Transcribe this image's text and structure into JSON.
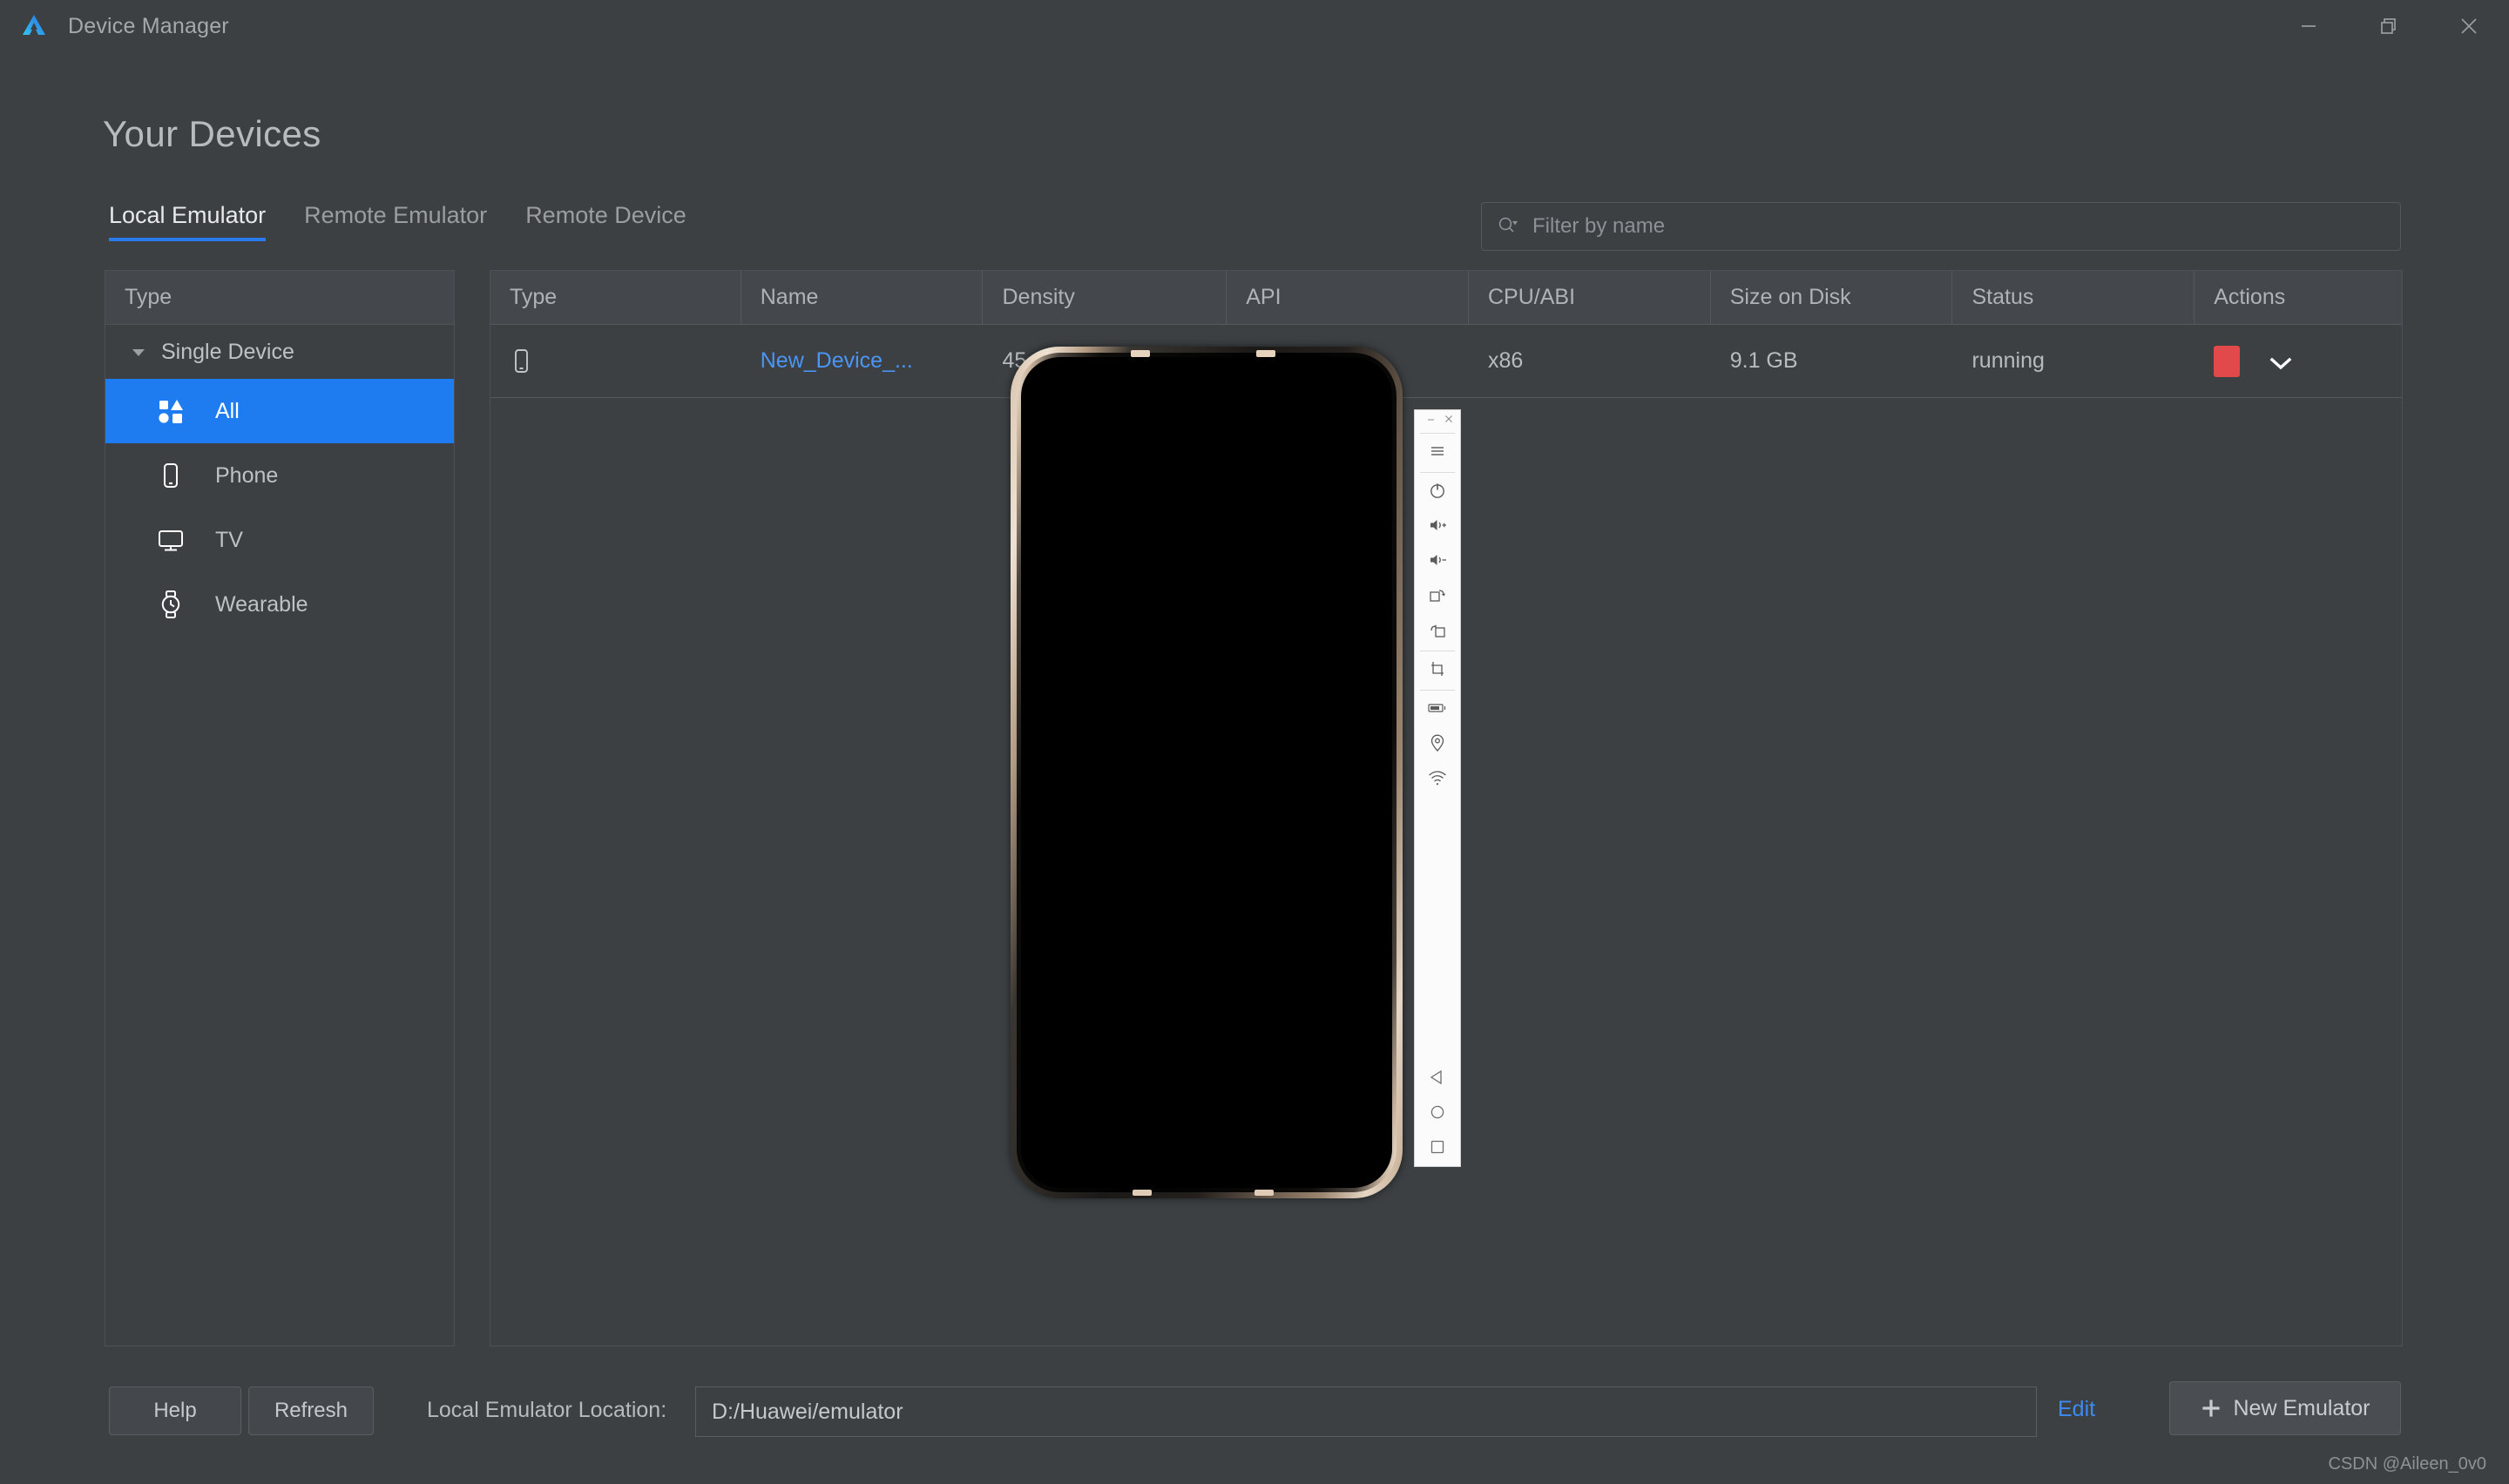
{
  "window": {
    "title": "Device Manager",
    "logo_icon": "deveco-logo-icon",
    "controls": [
      {
        "name": "minimize",
        "icon": "minimize-icon"
      },
      {
        "name": "restore",
        "icon": "restore-icon"
      },
      {
        "name": "close",
        "icon": "close-icon"
      }
    ]
  },
  "page": {
    "heading": "Your Devices"
  },
  "tabs": [
    {
      "label": "Local Emulator",
      "active": true
    },
    {
      "label": "Remote Emulator",
      "active": false
    },
    {
      "label": "Remote Device",
      "active": false
    }
  ],
  "search": {
    "icon": "search-icon",
    "placeholder": "Filter by name",
    "value": ""
  },
  "sidebar": {
    "header": "Type",
    "tree_group": {
      "label": "Single Device",
      "caret": "chevron-down-icon",
      "expanded": true
    },
    "items": [
      {
        "label": "All",
        "icon": "shapes-grid-icon",
        "selected": true
      },
      {
        "label": "Phone",
        "icon": "phone-icon",
        "selected": false
      },
      {
        "label": "TV",
        "icon": "tv-icon",
        "selected": false
      },
      {
        "label": "Wearable",
        "icon": "watch-icon",
        "selected": false
      }
    ]
  },
  "table": {
    "columns": [
      "Type",
      "Name",
      "Density",
      "API",
      "CPU/ABI",
      "Size on Disk",
      "Status",
      "Actions"
    ],
    "rows": [
      {
        "type_icon": "phone-icon",
        "name": "New_Device_...",
        "density": "45",
        "api": "",
        "cpu_abi": "x86",
        "size_on_disk": "9.1 GB",
        "status": "running",
        "actions": {
          "stop_icon": "stop-square-icon",
          "menu_icon": "chevron-down-icon"
        }
      }
    ]
  },
  "bottom_bar": {
    "help_label": "Help",
    "refresh_label": "Refresh",
    "location_label": "Local Emulator Location:",
    "location_value": "D:/Huawei/emulator",
    "edit_label": "Edit",
    "new_emulator_label": "New Emulator",
    "new_emulator_icon": "plus-icon"
  },
  "emulator": {
    "window_controls": [
      {
        "name": "minimize",
        "icon": "minimize-icon"
      },
      {
        "name": "close",
        "icon": "close-icon"
      }
    ],
    "toolbar_buttons": [
      {
        "name": "menu",
        "icon": "hamburger-menu-icon"
      },
      {
        "name": "power",
        "icon": "power-icon"
      },
      {
        "name": "volume-up",
        "icon": "volume-up-icon"
      },
      {
        "name": "volume-down",
        "icon": "volume-down-icon"
      },
      {
        "name": "rotate-right",
        "icon": "rotate-right-icon"
      },
      {
        "name": "rotate-left",
        "icon": "rotate-left-icon"
      },
      {
        "name": "screenshot",
        "icon": "crop-screenshot-icon"
      },
      {
        "name": "battery",
        "icon": "battery-icon"
      },
      {
        "name": "location",
        "icon": "location-pin-icon"
      },
      {
        "name": "network",
        "icon": "wifi-icon"
      }
    ],
    "nav_buttons": [
      {
        "name": "back",
        "icon": "back-triangle-icon"
      },
      {
        "name": "home",
        "icon": "home-circle-icon"
      },
      {
        "name": "recents",
        "icon": "recents-square-icon"
      }
    ],
    "screen_state": "black"
  },
  "watermark": "CSDN @Aileen_0v0",
  "colors": {
    "background": "#3c4043",
    "panel_header": "#44484c",
    "accent_blue": "#1e7cf0",
    "link_blue": "#4a95f5",
    "stop_red": "#e2494a",
    "border": "#4d5155",
    "text_primary": "#bfc2c5",
    "text_muted": "#8d9094"
  }
}
